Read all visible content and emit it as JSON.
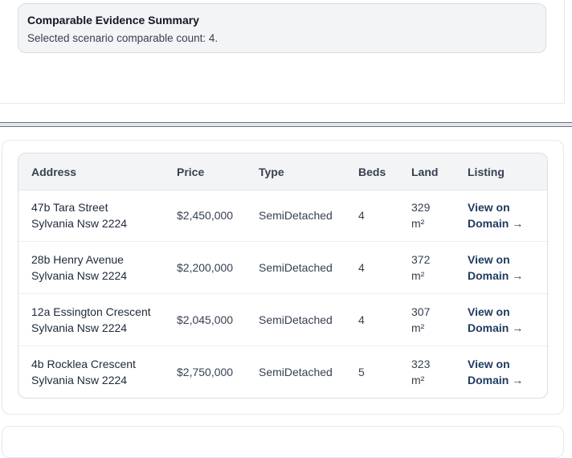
{
  "summary": {
    "title": "Comparable Evidence Summary",
    "text": "Selected scenario comparable count: 4."
  },
  "table": {
    "headers": {
      "address": "Address",
      "price": "Price",
      "type": "Type",
      "beds": "Beds",
      "land": "Land",
      "listing": "Listing"
    },
    "rows": [
      {
        "address_line1": "47b Tara Street",
        "address_line2": "Sylvania Nsw 2224",
        "price": "$2,450,000",
        "type": "SemiDetached",
        "beds": "4",
        "land_value": "329",
        "land_unit": "m²",
        "link_line1": "View on",
        "link_line2": "Domain →"
      },
      {
        "address_line1": "28b Henry Avenue",
        "address_line2": "Sylvania Nsw 2224",
        "price": "$2,200,000",
        "type": "SemiDetached",
        "beds": "4",
        "land_value": "372",
        "land_unit": "m²",
        "link_line1": "View on",
        "link_line2": "Domain →"
      },
      {
        "address_line1": "12a Essington Crescent",
        "address_line2": "Sylvania Nsw 2224",
        "price": "$2,045,000",
        "type": "SemiDetached",
        "beds": "4",
        "land_value": "307",
        "land_unit": "m²",
        "link_line1": "View on",
        "link_line2": "Domain →"
      },
      {
        "address_line1": "4b Rocklea Crescent",
        "address_line2": "Sylvania Nsw 2224",
        "price": "$2,750,000",
        "type": "SemiDetached",
        "beds": "5",
        "land_value": "323",
        "land_unit": "m²",
        "link_line1": "View on",
        "link_line2": "Domain →"
      }
    ]
  }
}
